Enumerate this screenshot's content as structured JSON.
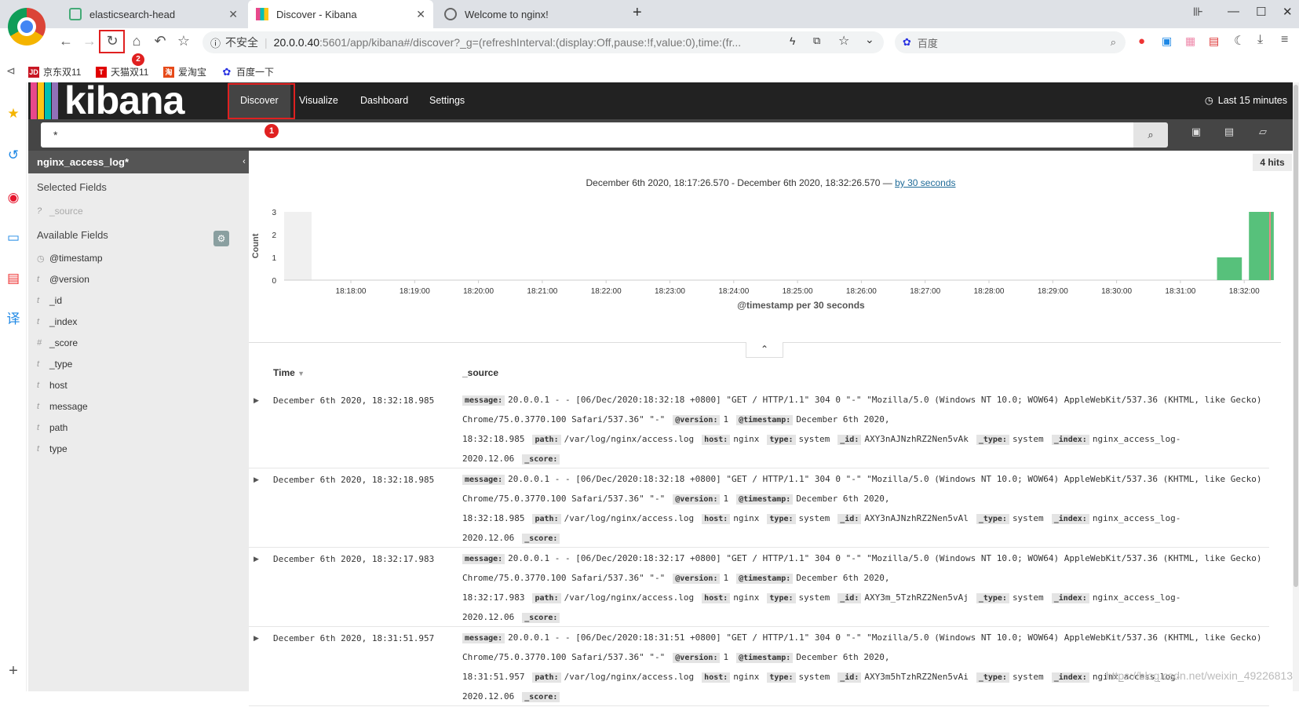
{
  "browser": {
    "tabs": [
      {
        "title": "elasticsearch-head",
        "active": false
      },
      {
        "title": "Discover - Kibana",
        "active": true
      },
      {
        "title": "Welcome to nginx!",
        "active": false
      }
    ],
    "security": "不安全",
    "url_host": "20.0.0.40",
    "url_rest": ":5601/app/kibana#/discover?_g=(refreshInterval:(display:Off,pause:!f,value:0),time:(fr...",
    "search_engine": "百度",
    "bookmarks": [
      {
        "label": "京东双11",
        "icon_text": "JD",
        "color": "#c81623"
      },
      {
        "label": "天猫双11",
        "icon_text": "T",
        "color": "#e00000"
      },
      {
        "label": "爱淘宝",
        "icon_text": "淘",
        "color": "#e64a19"
      },
      {
        "label": "百度一下",
        "icon_text": "",
        "color": "#2932e1"
      }
    ]
  },
  "kibana": {
    "logo": "kibana",
    "nav": [
      {
        "label": "Discover",
        "active": true
      },
      {
        "label": "Visualize",
        "active": false
      },
      {
        "label": "Dashboard",
        "active": false
      },
      {
        "label": "Settings",
        "active": false
      }
    ],
    "time_picker": "Last 15 minutes",
    "query": "*",
    "index_pattern": "nginx_access_log*",
    "selected_fields_title": "Selected Fields",
    "selected_fields": [
      {
        "type": "?",
        "name": "_source"
      }
    ],
    "available_fields_title": "Available Fields",
    "available_fields": [
      {
        "type": "clock",
        "name": "@timestamp"
      },
      {
        "type": "t",
        "name": "@version"
      },
      {
        "type": "t",
        "name": "_id"
      },
      {
        "type": "t",
        "name": "_index"
      },
      {
        "type": "#",
        "name": "_score"
      },
      {
        "type": "t",
        "name": "_type"
      },
      {
        "type": "t",
        "name": "host"
      },
      {
        "type": "t",
        "name": "message"
      },
      {
        "type": "t",
        "name": "path"
      },
      {
        "type": "t",
        "name": "type"
      }
    ],
    "hits": "4 hits",
    "range_text": "December 6th 2020, 18:17:26.570 - December 6th 2020, 18:32:26.570 —",
    "range_link": "by 30 seconds",
    "table_headers": {
      "time": "Time",
      "source": "_source"
    }
  },
  "chart_data": {
    "type": "bar",
    "title": "",
    "xlabel": "@timestamp per 30 seconds",
    "ylabel": "Count",
    "ylim": [
      0,
      3
    ],
    "yticks": [
      0,
      1,
      2,
      3
    ],
    "xticks": [
      "18:18:00",
      "18:19:00",
      "18:20:00",
      "18:21:00",
      "18:22:00",
      "18:23:00",
      "18:24:00",
      "18:25:00",
      "18:26:00",
      "18:27:00",
      "18:28:00",
      "18:29:00",
      "18:30:00",
      "18:31:00",
      "18:32:00"
    ],
    "categories": [
      "18:31:30",
      "18:32:00"
    ],
    "values": [
      1,
      3
    ],
    "bar_color": "#57c17b"
  },
  "documents": [
    {
      "time": "December 6th 2020, 18:32:18.985",
      "message": "20.0.0.1 - - [06/Dec/2020:18:32:18 +0800] \"GET / HTTP/1.1\" 304 0 \"-\" \"Mozilla/5.0 (Windows NT 10.0; WOW64) AppleWebKit/537.36 (KHTML, like Gecko) Chrome/75.0.3770.100 Safari/537.36\" \"-\"",
      "version": "1",
      "timestamp": "December 6th 2020, 18:32:18.985",
      "path": "/var/log/nginx/access.log",
      "host": "nginx",
      "type": "system",
      "id": "AXY3nAJNzhRZ2Nen5vAk",
      "_type": "system",
      "index": "nginx_access_log-2020.12.06",
      "score": ""
    },
    {
      "time": "December 6th 2020, 18:32:18.985",
      "message": "20.0.0.1 - - [06/Dec/2020:18:32:18 +0800] \"GET / HTTP/1.1\" 304 0 \"-\" \"Mozilla/5.0 (Windows NT 10.0; WOW64) AppleWebKit/537.36 (KHTML, like Gecko) Chrome/75.0.3770.100 Safari/537.36\" \"-\"",
      "version": "1",
      "timestamp": "December 6th 2020, 18:32:18.985",
      "path": "/var/log/nginx/access.log",
      "host": "nginx",
      "type": "system",
      "id": "AXY3nAJNzhRZ2Nen5vAl",
      "_type": "system",
      "index": "nginx_access_log-2020.12.06",
      "score": ""
    },
    {
      "time": "December 6th 2020, 18:32:17.983",
      "message": "20.0.0.1 - - [06/Dec/2020:18:32:17 +0800] \"GET / HTTP/1.1\" 304 0 \"-\" \"Mozilla/5.0 (Windows NT 10.0; WOW64) AppleWebKit/537.36 (KHTML, like Gecko) Chrome/75.0.3770.100 Safari/537.36\" \"-\"",
      "version": "1",
      "timestamp": "December 6th 2020, 18:32:17.983",
      "path": "/var/log/nginx/access.log",
      "host": "nginx",
      "type": "system",
      "id": "AXY3m_5TzhRZ2Nen5vAj",
      "_type": "system",
      "index": "nginx_access_log-2020.12.06",
      "score": ""
    },
    {
      "time": "December 6th 2020, 18:31:51.957",
      "message": "20.0.0.1 - - [06/Dec/2020:18:31:51 +0800] \"GET / HTTP/1.1\" 304 0 \"-\" \"Mozilla/5.0 (Windows NT 10.0; WOW64) AppleWebKit/537.36 (KHTML, like Gecko) Chrome/75.0.3770.100 Safari/537.36\" \"-\"",
      "version": "1",
      "timestamp": "December 6th 2020, 18:31:51.957",
      "path": "/var/log/nginx/access.log",
      "host": "nginx",
      "type": "system",
      "id": "AXY3m5hTzhRZ2Nen5vAi",
      "_type": "system",
      "index": "nginx_access_log-2020.12.06",
      "score": ""
    }
  ],
  "field_keys": {
    "message": "message:",
    "version": "@version:",
    "timestamp": "@timestamp:",
    "path": "path:",
    "host": "host:",
    "type": "type:",
    "id": "_id:",
    "_type": "_type:",
    "index": "_index:",
    "score": "_score:"
  },
  "annotations": [
    "1",
    "2"
  ],
  "watermark": "https://blog.csdn.net/weixin_49226813"
}
